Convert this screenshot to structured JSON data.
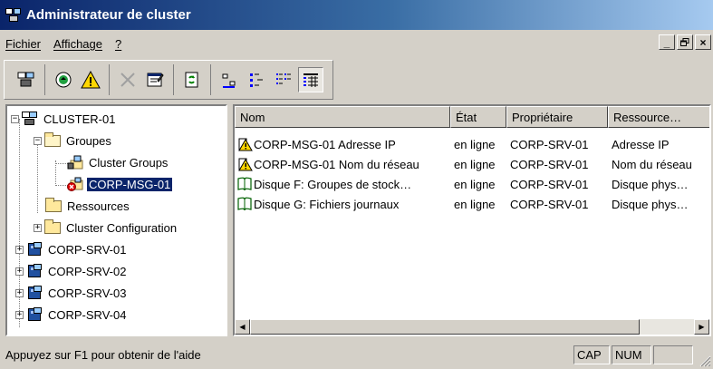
{
  "window": {
    "title": "Administrateur de cluster"
  },
  "menu": {
    "items": [
      "Fichier",
      "Affichage",
      "?"
    ],
    "mdi": [
      "_",
      "×"
    ]
  },
  "toolbar": {
    "buttons": [
      "cluster-open-icon",
      "bring-online-icon",
      "warning-icon",
      "delete-icon",
      "properties-icon",
      "refresh-icon",
      "large-icons-icon",
      "small-icons-icon",
      "list-view-icon",
      "details-view-icon"
    ]
  },
  "tree": {
    "root": "CLUSTER-01",
    "groups": "Groupes",
    "group_items": [
      "Cluster Groups",
      "CORP-MSG-01"
    ],
    "resources": "Ressources",
    "cluster_config": "Cluster Configuration",
    "servers": [
      "CORP-SRV-01",
      "CORP-SRV-02",
      "CORP-SRV-03",
      "CORP-SRV-04"
    ]
  },
  "list": {
    "columns": [
      "Nom",
      "État",
      "Propriétaire",
      "Ressource…"
    ],
    "rows": [
      {
        "name": "CORP-MSG-01 Adresse IP",
        "state": "en ligne",
        "owner": "CORP-SRV-01",
        "type": "Adresse IP",
        "icon": "warning-resource-icon"
      },
      {
        "name": "CORP-MSG-01 Nom du réseau",
        "state": "en ligne",
        "owner": "CORP-SRV-01",
        "type": "Nom du réseau",
        "icon": "warning-resource-icon"
      },
      {
        "name": "Disque F: Groupes de stock…",
        "state": "en ligne",
        "owner": "CORP-SRV-01",
        "type": "Disque phys…",
        "icon": "disk-resource-icon"
      },
      {
        "name": "Disque G: Fichiers journaux",
        "state": "en ligne",
        "owner": "CORP-SRV-01",
        "type": "Disque phys…",
        "icon": "disk-resource-icon"
      }
    ]
  },
  "status": {
    "help_text": "Appuyez sur F1 pour obtenir de l'aide",
    "caps": "CAP",
    "num": "NUM"
  }
}
